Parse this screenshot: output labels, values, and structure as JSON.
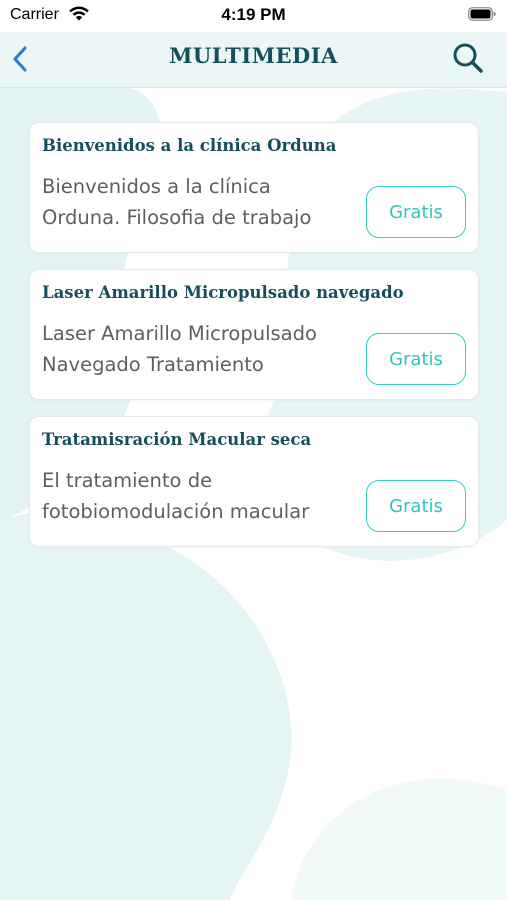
{
  "status_bar": {
    "carrier": "Carrier",
    "time": "4:19 PM"
  },
  "nav": {
    "title": "MULTIMEDIA",
    "back_icon": "chevron-left-icon",
    "search_icon": "search-icon"
  },
  "colors": {
    "accent": "#2cc7bf",
    "title": "#154f5c",
    "nav_icon": "#1f7fd0",
    "nav_background": "#ebf6f6"
  },
  "items": [
    {
      "title": "Bienvenidos a la clínica Orduna",
      "description": "Bienvenidos a la clínica Orduna. Filosofia de trabajo",
      "price": "Gratis"
    },
    {
      "title": "Laser Amarillo Micropulsado navegado",
      "description": "Laser Amarillo Micropulsado Navegado Tratamiento",
      "price": "Gratis"
    },
    {
      "title": "Tratamisración Macular seca",
      "description": "El tratamiento de fotobiomodulación macular",
      "price": "Gratis"
    }
  ]
}
